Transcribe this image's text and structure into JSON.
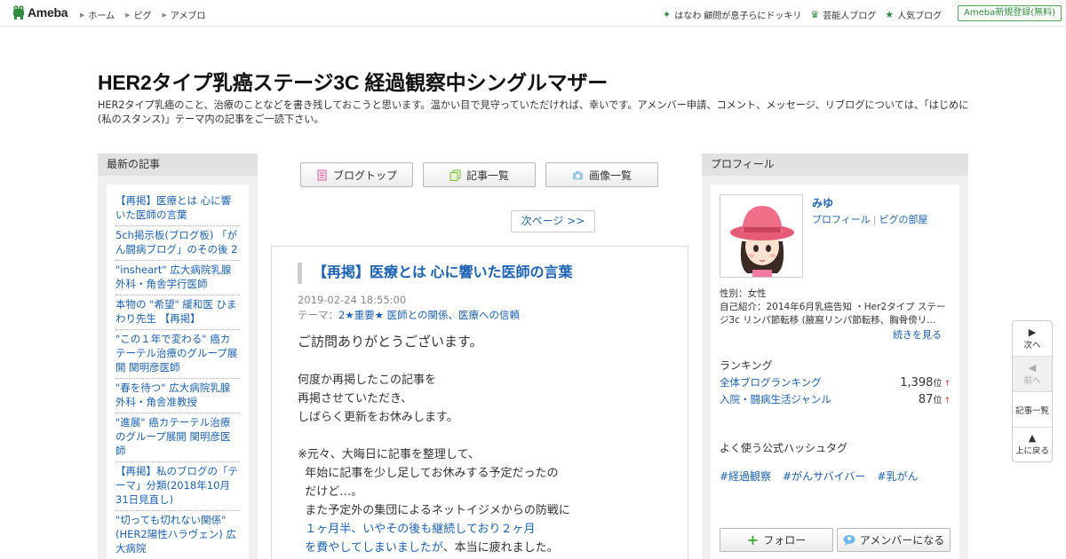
{
  "topbar": {
    "logo_text": "Ameba",
    "nav_left": [
      "ホーム",
      "ピグ",
      "アメブロ"
    ],
    "nav_right": [
      {
        "icon": "sparkle-icon",
        "label": "はなわ 顧問が息子らにドッキリ"
      },
      {
        "icon": "crown-icon",
        "label": "芸能人ブログ"
      },
      {
        "icon": "star-icon",
        "label": "人気ブログ"
      }
    ],
    "register_label": "Ameba新規登録(無料)"
  },
  "header": {
    "title": "HER2タイプ乳癌ステージ3C 経過観察中シングルマザー",
    "description": "HER2タイプ乳癌のこと、治療のことなどを書き残しておこうと思います。温かい目で見守っていただければ、幸いです。アメンバー申請、コメント、メッセージ、リブログについては、「はじめに(私のスタンス)」テーマ内の記事をご一読下さい。"
  },
  "left_sidebar": {
    "heading": "最新の記事",
    "items": [
      "【再掲】医療とは 心に響いた医師の言葉",
      "5ch掲示板(ブログ板) 「がん闘病ブログ」のその後 2",
      "\"insheart\" 広大病院乳腺外科・角舎学行医師",
      "本物の \"希望\" 緩和医 ひまわり先生 【再掲】",
      "\"この１年で変わる\" 癌カテーテル治療のグループ展開 関明彦医師",
      "\"春を待つ\" 広大病院乳腺外科・角舎准教授",
      "\"進展\" 癌カテーテル治療のグループ展開 関明彦医師",
      "【再掲】私のブログの「テーマ」分類(2018年10月31日見直し)",
      "\"切っても切れない関係\" (HER2陽性ハラヴェン) 広大病院"
    ]
  },
  "center": {
    "buttons": [
      {
        "icon": "document-icon",
        "label": "ブログトップ"
      },
      {
        "icon": "copy-icon",
        "label": "記事一覧"
      },
      {
        "icon": "camera-icon",
        "label": "画像一覧"
      }
    ],
    "next_page": "次ページ >>",
    "article": {
      "title": "【再掲】医療とは 心に響いた医師の言葉",
      "date": "2019-02-24 18:55:00",
      "theme_prefix": "テーマ：",
      "theme": "2★重要★ 医師との関係、医療への信頼",
      "lead": "ご訪問ありがとうございます。",
      "para1": [
        "何度か再掲したこの記事を",
        "再掲させていただき、",
        "しばらく更新をお休みします。"
      ],
      "para2_lines": [
        "※元々、大晦日に記事を整理して、",
        "  年始に記事を少し足してお休みする予定だったの",
        "  だけど…。",
        "  また予定外の集団によるネットイジメからの防戦に"
      ],
      "para2_blue_1": "  １ヶ月半、いやその後も継続しており２ヶ月",
      "para2_blue_2": "  を費やしてしまいましたが",
      "para2_tail": "、本当に疲れました。"
    }
  },
  "right_sidebar": {
    "heading": "プロフィール",
    "name": "みゆ",
    "link_profile": "プロフィール",
    "link_pig": "ピグの部屋",
    "gender": "性別：女性",
    "intro": "自己紹介：2014年6月乳癌告知 ・Her2タイプ ステージ3c リンパ節転移 (腋窩リンパ節転移、胸骨傍リ...",
    "more": "続きを見る",
    "ranking_label": "ランキング",
    "rankings": [
      {
        "name": "全体ブログランキング",
        "value": "1,398",
        "unit": "位",
        "arrow": "↑"
      },
      {
        "name": "入院・闘病生活ジャンル",
        "value": "87",
        "unit": "位",
        "arrow": "↑"
      }
    ],
    "hashtag_label": "よく使う公式ハッシュタグ",
    "hashtags": [
      "#経過観察",
      "#がんサバイバー",
      "#乳がん"
    ],
    "follow": "フォロー",
    "member": "アメンバーになる"
  },
  "float_nav": {
    "next": "次へ",
    "prev": "前へ",
    "list": "記事一覧",
    "top": "上に戻る"
  }
}
